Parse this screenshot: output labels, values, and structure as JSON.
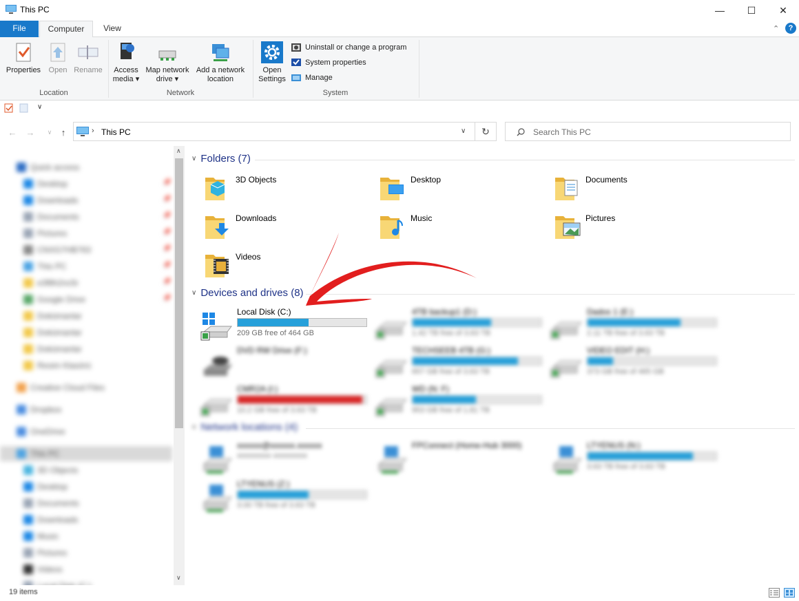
{
  "window": {
    "title": "This PC",
    "controls": {
      "minimize": "—",
      "maximize": "☐",
      "close": "✕"
    }
  },
  "ribbon_tabs": [
    {
      "label": "File"
    },
    {
      "label": "Computer"
    },
    {
      "label": "View"
    }
  ],
  "ribbon": {
    "location": {
      "label": "Location",
      "buttons": [
        {
          "label": "Properties",
          "icon": "properties-icon",
          "enabled": true
        },
        {
          "label": "Open",
          "icon": "open-icon",
          "enabled": false
        },
        {
          "label": "Rename",
          "icon": "rename-icon",
          "enabled": false
        }
      ]
    },
    "network": {
      "label": "Network",
      "buttons": [
        {
          "line1": "Access",
          "line2": "media ▾",
          "icon": "media-icon"
        },
        {
          "line1": "Map network",
          "line2": "drive ▾",
          "icon": "map-drive-icon"
        },
        {
          "line1": "Add a network",
          "line2": "location",
          "icon": "network-location-icon"
        }
      ]
    },
    "system": {
      "label": "System",
      "open_settings": {
        "line1": "Open",
        "line2": "Settings",
        "icon": "gear-icon"
      },
      "items": [
        {
          "label": "Uninstall or change a program",
          "icon": "uninstall-icon"
        },
        {
          "label": "System properties",
          "icon": "system-properties-icon"
        },
        {
          "label": "Manage",
          "icon": "manage-icon"
        }
      ]
    }
  },
  "address": {
    "path": "This PC",
    "separator": "›"
  },
  "search": {
    "placeholder": "Search This PC"
  },
  "nav_pane": {
    "items": [
      {
        "label": "Quick access",
        "indent": 0,
        "color": "#2b6cc4",
        "pinned": false
      },
      {
        "label": "Desktop",
        "indent": 1,
        "color": "#1e88e5",
        "pinned": true
      },
      {
        "label": "Downloads",
        "indent": 1,
        "color": "#1e88e5",
        "pinned": true
      },
      {
        "label": "Documents",
        "indent": 1,
        "color": "#9aa5b5",
        "pinned": true
      },
      {
        "label": "Pictures",
        "indent": 1,
        "color": "#9aa5b5",
        "pinned": true
      },
      {
        "label": "CNXG7HB763",
        "indent": 1,
        "color": "#8a8a8a",
        "pinned": true
      },
      {
        "label": "This PC",
        "indent": 1,
        "color": "#4ba3e3",
        "pinned": true
      },
      {
        "label": "e3f8h2nc5r",
        "indent": 1,
        "color": "#f2c94c",
        "pinned": true
      },
      {
        "label": "Google Drive",
        "indent": 1,
        "color": "#5aa869",
        "pinned": true
      },
      {
        "label": "Dokümanlar",
        "indent": 1,
        "color": "#f2c94c",
        "pinned": false
      },
      {
        "label": "Dokümanlar",
        "indent": 1,
        "color": "#f2c94c",
        "pinned": false
      },
      {
        "label": "Dokümanlar",
        "indent": 1,
        "color": "#f2c94c",
        "pinned": false
      },
      {
        "label": "Resim Klasörü",
        "indent": 1,
        "color": "#f2c94c",
        "pinned": false
      },
      {
        "label": "Creative Cloud Files",
        "indent": 0,
        "color": "#f2a14c",
        "pinned": false
      },
      {
        "label": "Dropbox",
        "indent": 0,
        "color": "#4b8de0",
        "pinned": false
      },
      {
        "label": "OneDrive",
        "indent": 0,
        "color": "#4b8de0",
        "pinned": false
      },
      {
        "label": "This PC",
        "indent": 0,
        "color": "#4ba3e3",
        "pinned": false,
        "selected": true
      },
      {
        "label": "3D Objects",
        "indent": 1,
        "color": "#4bb5e0",
        "pinned": false
      },
      {
        "label": "Desktop",
        "indent": 1,
        "color": "#1e88e5",
        "pinned": false
      },
      {
        "label": "Documents",
        "indent": 1,
        "color": "#9aa5b5",
        "pinned": false
      },
      {
        "label": "Downloads",
        "indent": 1,
        "color": "#1e88e5",
        "pinned": false
      },
      {
        "label": "Music",
        "indent": 1,
        "color": "#1e88e5",
        "pinned": false
      },
      {
        "label": "Pictures",
        "indent": 1,
        "color": "#9aa5b5",
        "pinned": false
      },
      {
        "label": "Videos",
        "indent": 1,
        "color": "#333333",
        "pinned": false
      },
      {
        "label": "Local Disk (C:)",
        "indent": 1,
        "color": "#9aa5b5",
        "pinned": false
      }
    ]
  },
  "content": {
    "folders_header": "Folders (7)",
    "folders": [
      {
        "label": "3D Objects",
        "icon": "3d-objects-folder-icon"
      },
      {
        "label": "Desktop",
        "icon": "desktop-folder-icon"
      },
      {
        "label": "Documents",
        "icon": "documents-folder-icon"
      },
      {
        "label": "Downloads",
        "icon": "downloads-folder-icon"
      },
      {
        "label": "Music",
        "icon": "music-folder-icon"
      },
      {
        "label": "Pictures",
        "icon": "pictures-folder-icon"
      },
      {
        "label": "Videos",
        "icon": "videos-folder-icon"
      }
    ],
    "drives_header": "Devices and drives (8)",
    "drives": [
      {
        "label": "Local Disk (C:)",
        "free": "209 GB free of 464 GB",
        "used_fraction": 0.55,
        "bar_color": "#26a0da",
        "blurred": false,
        "has_bar": true,
        "icon": "system-drive-icon"
      },
      {
        "label": "4TB backup1 (D:)",
        "free": "1.42 TB free of 3.63 TB",
        "used_fraction": 0.61,
        "bar_color": "#26a0da",
        "blurred": true,
        "has_bar": true,
        "icon": "drive-icon"
      },
      {
        "label": "Dados 1 (E:)",
        "free": "2.11 TB free of 3.63 TB",
        "used_fraction": 0.72,
        "bar_color": "#26a0da",
        "blurred": true,
        "has_bar": true,
        "icon": "drive-icon"
      },
      {
        "label": "DVD RW Drive (F:)",
        "free": "",
        "used_fraction": 0,
        "bar_color": "#26a0da",
        "blurred": true,
        "has_bar": false,
        "icon": "dvd-drive-icon"
      },
      {
        "label": "TECHSEEB 4TB (G:)",
        "free": "657 GB free of 3.63 TB",
        "used_fraction": 0.82,
        "bar_color": "#26a0da",
        "blurred": true,
        "has_bar": true,
        "icon": "drive-icon"
      },
      {
        "label": "VIDEO EDIT (H:)",
        "free": "373 GB free of 465 GB",
        "used_fraction": 0.2,
        "bar_color": "#26a0da",
        "blurred": true,
        "has_bar": true,
        "icon": "drive-icon"
      },
      {
        "label": "CMR2A (I:)",
        "free": "10.2 GB free of 3.63 TB",
        "used_fraction": 0.97,
        "bar_color": "#da2626",
        "blurred": true,
        "has_bar": true,
        "icon": "drive-icon"
      },
      {
        "label": "WD (N: F)",
        "free": "953 GB free of 1.81 TB",
        "used_fraction": 0.49,
        "bar_color": "#26a0da",
        "blurred": true,
        "has_bar": true,
        "icon": "drive-icon"
      }
    ],
    "network_header": "Network locations (4)",
    "network": [
      {
        "label": "xxxxxx@xxxxxx.xxxxxx",
        "sub": "xxxxxxxxx xxxxxxxxx",
        "has_bar": false,
        "used_fraction": 0
      },
      {
        "label": "FPConnect (Home-Hub 3000)",
        "sub": "",
        "has_bar": false,
        "used_fraction": 0
      },
      {
        "label": "LTYENUS (N:)",
        "sub": "3.63 TB free of 3.63 TB",
        "has_bar": true,
        "used_fraction": 0.82
      },
      {
        "label": "LTYENUS (Z:)",
        "sub": "3.00 TB free of 3.63 TB",
        "has_bar": true,
        "used_fraction": 0.55
      }
    ]
  },
  "status": {
    "count": "19 items"
  }
}
